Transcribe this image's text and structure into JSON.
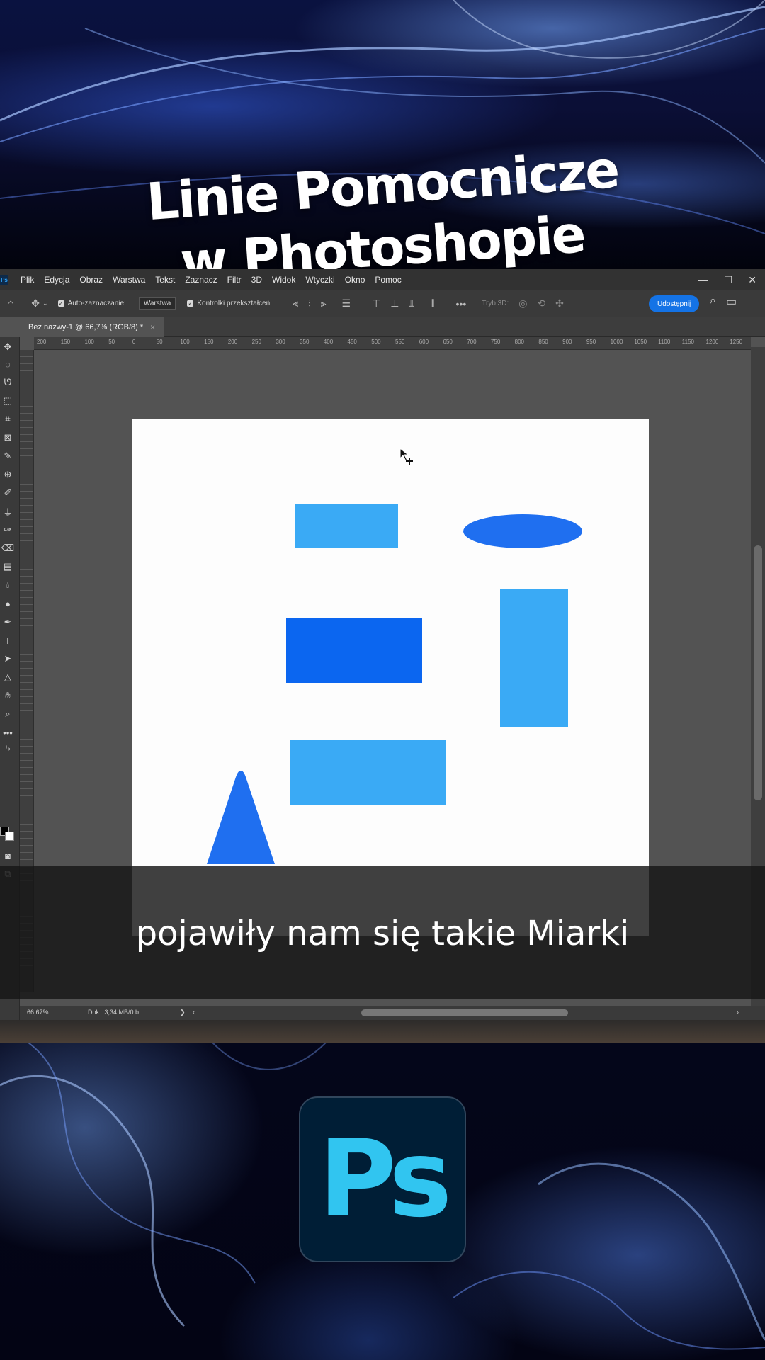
{
  "title": {
    "line1": "Linie Pomocnicze",
    "line2": "w Photoshopie"
  },
  "caption": "pojawiły nam się takie Miarki",
  "menu": [
    "Plik",
    "Edycja",
    "Obraz",
    "Warstwa",
    "Tekst",
    "Zaznacz",
    "Filtr",
    "3D",
    "Widok",
    "Wtyczki",
    "Okno",
    "Pomoc"
  ],
  "options": {
    "auto_select_label": "Auto-zaznaczanie:",
    "auto_select_value": "Warstwa",
    "transform_controls_label": "Kontrolki przekształceń",
    "mode_3d": "Tryb 3D:",
    "share_button": "Udostępnij"
  },
  "document_tab": {
    "title": "Bez nazwy-1 @ 66,7% (RGB/8) *",
    "close": "×"
  },
  "ruler_labels": [
    "200",
    "150",
    "100",
    "50",
    "0",
    "50",
    "100",
    "150",
    "200",
    "250",
    "300",
    "350",
    "400",
    "450",
    "500",
    "550",
    "600",
    "650",
    "700",
    "750",
    "800",
    "850",
    "900",
    "950",
    "1000",
    "1050",
    "1100",
    "1150",
    "1200",
    "1250"
  ],
  "status": {
    "zoom": "66,67%",
    "doc_size": "Dok.: 3,34 MB/0 b"
  },
  "logo_text": "Ps",
  "colors": {
    "light_blue": "#3aaaf5",
    "dark_blue": "#0b66f0",
    "mid_blue": "#1f6ff0",
    "share_button": "#1473e6",
    "logo_bg": "#001e36",
    "logo_text": "#31c5f0"
  }
}
